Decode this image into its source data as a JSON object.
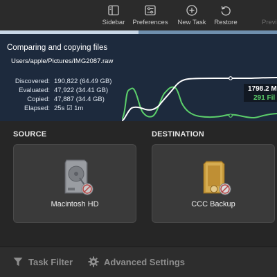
{
  "toolbar": {
    "items": [
      {
        "label": "Sidebar",
        "icon": "sidebar-icon"
      },
      {
        "label": "Preferences",
        "icon": "sliders-icon"
      },
      {
        "label": "New Task",
        "icon": "plus-circle-icon"
      },
      {
        "label": "Restore",
        "icon": "restore-arrow-icon"
      },
      {
        "label": "Previ",
        "icon": "preview-icon"
      }
    ]
  },
  "progress": {
    "fraction": 0.5
  },
  "status": {
    "title": "Comparing and copying files",
    "path": "Users/apple/Pictures/IMG2087.raw",
    "stats": [
      {
        "key": "Discovered:",
        "value": "190,822 (64.49 GB)"
      },
      {
        "key": "Evaluated:",
        "value": "47,922 (34.41 GB)"
      },
      {
        "key": "Copied:",
        "value": "47,887 (34.4 GB)"
      },
      {
        "key": "Elapsed:",
        "value": "25s ☑ 1m"
      }
    ],
    "readout_total": "1798.2 M",
    "readout_files": "291 Fil"
  },
  "colors": {
    "data_line": "#ffffff",
    "files_line": "#5cd06b",
    "status_bg": "#1d2a3d"
  },
  "source": {
    "section_label": "SOURCE",
    "volume_name": "Macintosh HD",
    "icon": "hard-drive-icon"
  },
  "destination": {
    "section_label": "DESTINATION",
    "volume_name": "CCC Backup",
    "icon": "external-drive-icon"
  },
  "bottom": {
    "task_filter_label": "Task Filter",
    "advanced_settings_label": "Advanced Settings"
  }
}
